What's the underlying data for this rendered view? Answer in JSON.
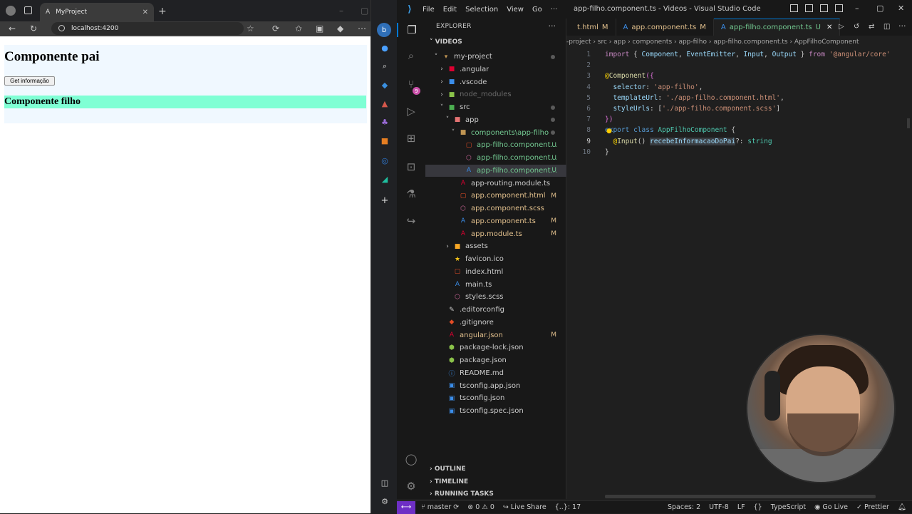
{
  "browser": {
    "tab_title": "MyProject",
    "url": "localhost:4200",
    "page": {
      "parent_title": "Componente pai",
      "button_label": "Get informação",
      "child_title": "Componente filho"
    }
  },
  "vscode": {
    "menu": [
      "File",
      "Edit",
      "Selection",
      "View",
      "Go",
      "···"
    ],
    "window_title": "app-filho.component.ts - Videos - Visual Studio Code",
    "explorer_title": "EXPLORER",
    "section": "VIDEOS",
    "tree": [
      {
        "name": "my-project",
        "indent": 1,
        "chev": "˅",
        "icon": "folder-open",
        "status": "dot"
      },
      {
        "name": ".angular",
        "indent": 2,
        "chev": "›",
        "icon": "folder-angular",
        "status": ""
      },
      {
        "name": ".vscode",
        "indent": 2,
        "chev": "›",
        "icon": "folder-vscode",
        "status": ""
      },
      {
        "name": "node_modules",
        "indent": 2,
        "chev": "›",
        "icon": "folder-node",
        "status": "",
        "dim": true
      },
      {
        "name": "src",
        "indent": 2,
        "chev": "˅",
        "icon": "folder-src",
        "status": "dot"
      },
      {
        "name": "app",
        "indent": 3,
        "chev": "˅",
        "icon": "folder-app",
        "status": "dot"
      },
      {
        "name": "components\\app-filho",
        "indent": 4,
        "chev": "˅",
        "icon": "folder-components",
        "status": "dot",
        "accent": "#73c991"
      },
      {
        "name": "app-filho.component...",
        "indent": 5,
        "chev": "",
        "icon": "html",
        "status": "U",
        "accent": "#73c991"
      },
      {
        "name": "app-filho.component...",
        "indent": 5,
        "chev": "",
        "icon": "scss",
        "status": "U",
        "accent": "#73c991"
      },
      {
        "name": "app-filho.component...",
        "indent": 5,
        "chev": "",
        "icon": "ts",
        "status": "U",
        "accent": "#73c991",
        "selected": true
      },
      {
        "name": "app-routing.module.ts",
        "indent": 4,
        "chev": "",
        "icon": "angular",
        "status": ""
      },
      {
        "name": "app.component.html",
        "indent": 4,
        "chev": "",
        "icon": "html",
        "status": "M",
        "accent": "#e2c08d"
      },
      {
        "name": "app.component.scss",
        "indent": 4,
        "chev": "",
        "icon": "scss",
        "status": "",
        "accent": "#e2c08d"
      },
      {
        "name": "app.component.ts",
        "indent": 4,
        "chev": "",
        "icon": "ts",
        "status": "M",
        "accent": "#e2c08d"
      },
      {
        "name": "app.module.ts",
        "indent": 4,
        "chev": "",
        "icon": "angular",
        "status": "M",
        "accent": "#e2c08d"
      },
      {
        "name": "assets",
        "indent": 3,
        "chev": "›",
        "icon": "folder-assets",
        "status": ""
      },
      {
        "name": "favicon.ico",
        "indent": 3,
        "chev": "",
        "icon": "star",
        "status": ""
      },
      {
        "name": "index.html",
        "indent": 3,
        "chev": "",
        "icon": "html",
        "status": ""
      },
      {
        "name": "main.ts",
        "indent": 3,
        "chev": "",
        "icon": "ts",
        "status": ""
      },
      {
        "name": "styles.scss",
        "indent": 3,
        "chev": "",
        "icon": "scss",
        "status": ""
      },
      {
        "name": ".editorconfig",
        "indent": 2,
        "chev": "",
        "icon": "editorconfig",
        "status": ""
      },
      {
        "name": ".gitignore",
        "indent": 2,
        "chev": "",
        "icon": "git",
        "status": ""
      },
      {
        "name": "angular.json",
        "indent": 2,
        "chev": "",
        "icon": "angular",
        "status": "M",
        "accent": "#e2c08d"
      },
      {
        "name": "package-lock.json",
        "indent": 2,
        "chev": "",
        "icon": "node",
        "status": ""
      },
      {
        "name": "package.json",
        "indent": 2,
        "chev": "",
        "icon": "node",
        "status": ""
      },
      {
        "name": "README.md",
        "indent": 2,
        "chev": "",
        "icon": "info",
        "status": ""
      },
      {
        "name": "tsconfig.app.json",
        "indent": 2,
        "chev": "",
        "icon": "tsconfig",
        "status": ""
      },
      {
        "name": "tsconfig.json",
        "indent": 2,
        "chev": "",
        "icon": "tsconfig",
        "status": ""
      },
      {
        "name": "tsconfig.spec.json",
        "indent": 2,
        "chev": "",
        "icon": "tsconfig",
        "status": ""
      }
    ],
    "bottom_sections": [
      "OUTLINE",
      "TIMELINE",
      "RUNNING TASKS"
    ],
    "tabs": [
      {
        "label": "t.html",
        "status": "M",
        "icon": "html"
      },
      {
        "label": "app.component.ts",
        "status": "M",
        "icon": "angular"
      },
      {
        "label": "app-filho.component.ts",
        "status": "U",
        "icon": "angular",
        "active": true
      }
    ],
    "breadcrumbs": "-project › src › app › components › app-filho › app-filho.component.ts › AppFilhoComponent",
    "code": [
      [
        [
          "k",
          "import"
        ],
        [
          "p",
          " { "
        ],
        [
          "v",
          "Component"
        ],
        [
          "p",
          ", "
        ],
        [
          "v",
          "EventEmitter"
        ],
        [
          "p",
          ", "
        ],
        [
          "v",
          "Input"
        ],
        [
          "p",
          ", "
        ],
        [
          "v",
          "Output"
        ],
        [
          "p",
          " } "
        ],
        [
          "k",
          "from"
        ],
        [
          "p",
          " "
        ],
        [
          "s",
          "'@angular/core'"
        ]
      ],
      [],
      [
        [
          "y",
          "@"
        ],
        [
          "f",
          "Component"
        ],
        [
          "pl",
          "({"
        ]
      ],
      [
        [
          "p",
          "  "
        ],
        [
          "v",
          "selector"
        ],
        [
          "p",
          ": "
        ],
        [
          "s",
          "'app-filho'"
        ],
        [
          "p",
          ","
        ]
      ],
      [
        [
          "p",
          "  "
        ],
        [
          "v",
          "templateUrl"
        ],
        [
          "p",
          ": "
        ],
        [
          "s",
          "'./app-filho.component.html'"
        ],
        [
          "p",
          ","
        ]
      ],
      [
        [
          "p",
          "  "
        ],
        [
          "v",
          "styleUrls"
        ],
        [
          "p",
          ": ["
        ],
        [
          "s",
          "'./app-filho.component.scss'"
        ],
        [
          "p",
          "]"
        ]
      ],
      [
        [
          "pl",
          "})"
        ]
      ],
      [
        [
          "k2",
          "export"
        ],
        [
          "p",
          " "
        ],
        [
          "k2",
          "class"
        ],
        [
          "p",
          " "
        ],
        [
          "t",
          "AppFilhoComponent"
        ],
        [
          "p",
          " {"
        ]
      ],
      [
        [
          "p",
          "  "
        ],
        [
          "y",
          "@"
        ],
        [
          "f",
          "Input"
        ],
        [
          "p",
          "() "
        ],
        [
          "vh",
          "recebeInformacaoDoPai"
        ],
        [
          "p",
          "?: "
        ],
        [
          "t",
          "string"
        ]
      ],
      [
        [
          "p",
          "}"
        ]
      ]
    ],
    "current_line": 9,
    "status": {
      "branch": "master",
      "errors": "0",
      "warnings": "0",
      "live_share": "Live Share",
      "cursor": "{..}: 17",
      "spaces": "Spaces: 2",
      "encoding": "UTF-8",
      "eol": "LF",
      "lang_braces": "{}",
      "language": "TypeScript",
      "go_live": "Go Live",
      "prettier": "Prettier"
    }
  },
  "colors": {
    "accent_blue": "#0078d4",
    "child_bg": "#7fffd4",
    "parent_bg": "#f0f8ff",
    "git_untracked": "#73c991",
    "git_modified": "#e2c08d"
  }
}
